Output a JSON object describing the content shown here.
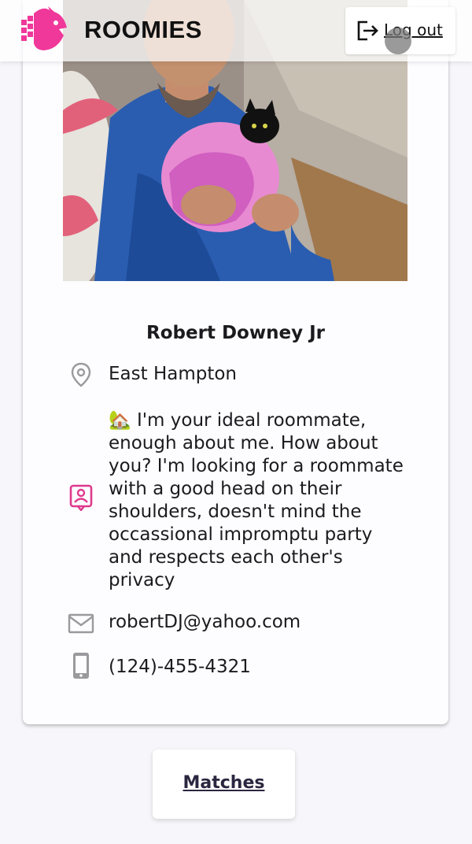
{
  "header": {
    "brand": "ROOMIES",
    "logout_label": "Log out",
    "accent": "#f0389a"
  },
  "profile": {
    "name": "Robert Downey Jr",
    "location": "East Hampton",
    "bio": "🏡 I'm your ideal roommate, enough about me. How about you? I'm looking for a roommate with a good head on their shoulders, doesn't mind the occassional impromptu party and respects each other's privacy",
    "email": "robertDJ@yahoo.com",
    "phone": "(124)-455-4321",
    "icons": {
      "location": "location-pin-icon",
      "bio": "contact-card-icon",
      "email": "envelope-icon",
      "phone": "mobile-phone-icon"
    }
  },
  "footer": {
    "matches_label": "Matches"
  }
}
